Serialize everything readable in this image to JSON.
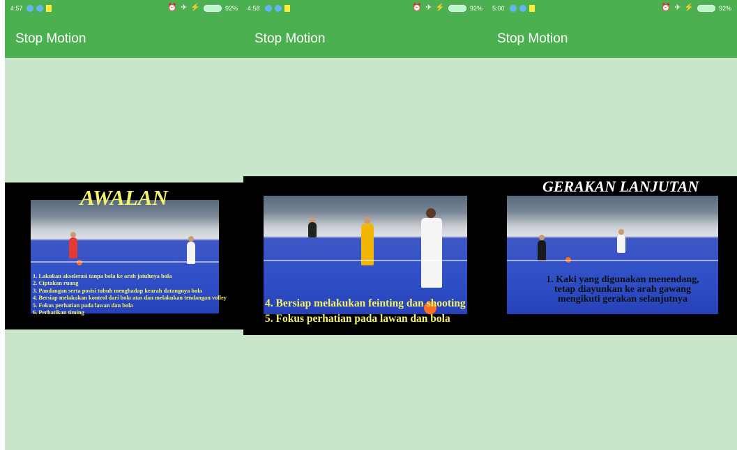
{
  "panels": [
    {
      "status": {
        "time": "4:57",
        "battery": "92%"
      },
      "appbar": {
        "title": "Stop Motion"
      },
      "slide": {
        "heading": "AWALAN",
        "lines": [
          "1. Lakukan akselerasi tanpa bola ke arah jatuhnya bola",
          "2. Ciptakan ruang",
          "3. Pandangan serta posisi tubuh menghadap kearah datangnya bola",
          "4. Bersiap melakukan kontrol dari bola atas dan melakukan tendangan volley",
          "5. Fokus perhatian pada lawan dan bola",
          "6. Perhatikan timing"
        ]
      }
    },
    {
      "status": {
        "time": "4:58",
        "battery": "92%"
      },
      "appbar": {
        "title": "Stop Motion"
      },
      "slide": {
        "lines": [
          "4. Bersiap melakukan feinting dan shooting",
          "5. Fokus perhatian pada lawan dan bola"
        ]
      }
    },
    {
      "status": {
        "time": "5:00",
        "battery": "92%"
      },
      "appbar": {
        "title": "Stop Motion"
      },
      "slide": {
        "heading": "GERAKAN LANJUTAN",
        "lines": [
          "1. Kaki yang digunakan menendang,",
          "tetap diayunkan ke arah gawang",
          "mengikuti gerakan selanjutnya"
        ]
      }
    }
  ],
  "icons": {
    "status_left": [
      "location-icon",
      "vpn-icon",
      "notification-icon"
    ],
    "status_right": [
      "alarm-icon",
      "airplane-mode-icon",
      "charging-icon",
      "battery-icon"
    ]
  },
  "colors": {
    "app_bar": "#4caf50",
    "content_background": "#c8e6c9",
    "slide_background": "#000000",
    "slide_text_yellow": "#f4f16a",
    "slide_text_white": "#ffffff"
  }
}
